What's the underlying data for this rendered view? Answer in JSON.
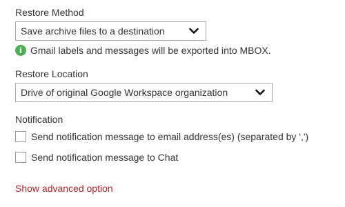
{
  "restore_method": {
    "label": "Restore Method",
    "selected": "Save archive files to a destination",
    "info_text": "Gmail labels and messages will be exported into MBOX.",
    "info_icon": "info-icon"
  },
  "restore_location": {
    "label": "Restore Location",
    "selected": "Drive of original Google Workspace organization"
  },
  "notification": {
    "label": "Notification",
    "options": [
      {
        "label": "Send notification message to email address(es) (separated by ',')",
        "checked": false
      },
      {
        "label": "Send notification message to Chat",
        "checked": false
      }
    ]
  },
  "advanced_link": "Show advanced option",
  "colors": {
    "info_green": "#4caf50",
    "link_red": "#b5242d",
    "border": "#a8a8a8"
  }
}
